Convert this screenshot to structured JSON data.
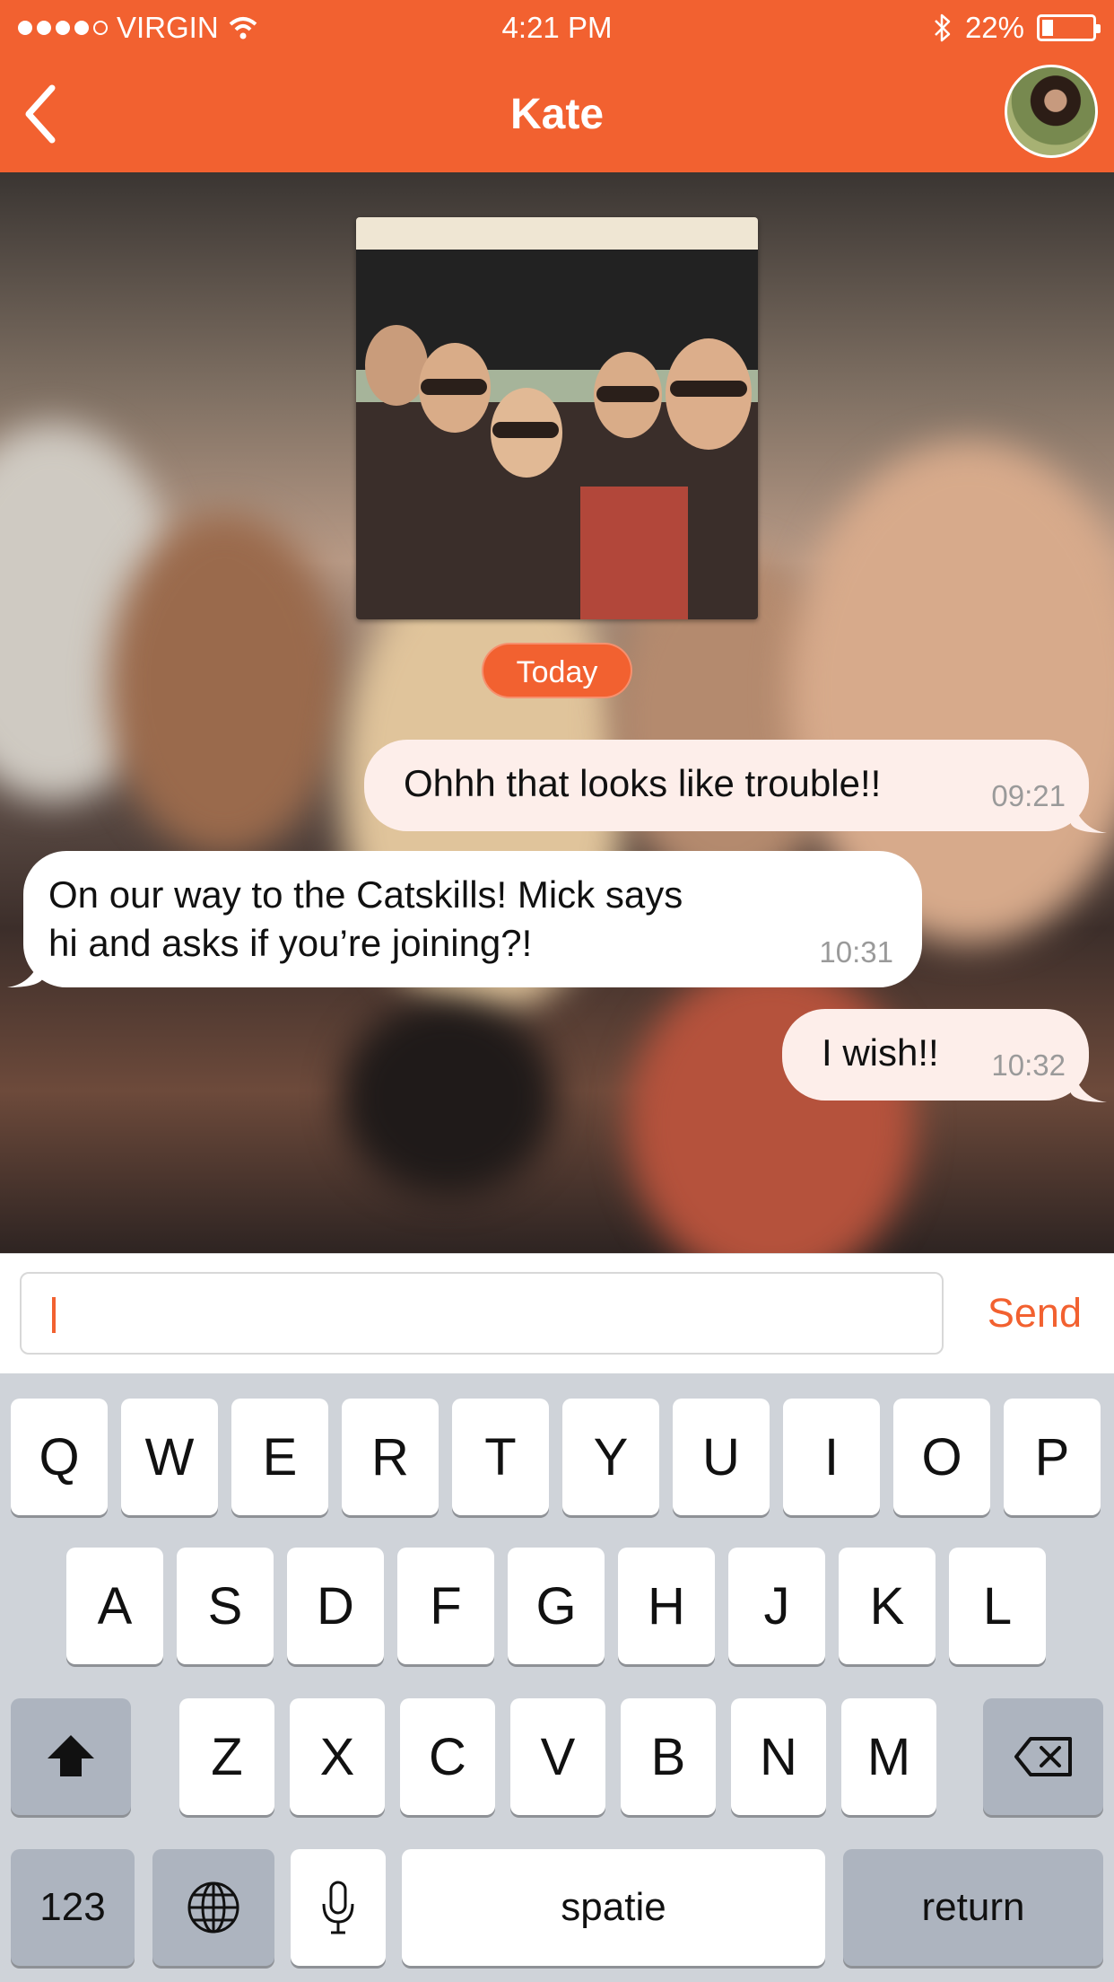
{
  "status_bar": {
    "carrier": "VIRGIN",
    "time": "4:21 PM",
    "battery": "22%",
    "signal_bars_filled": 4,
    "signal_bars_total": 5,
    "battery_level": 0.22,
    "icons": [
      "wifi-icon",
      "bluetooth-icon",
      "battery-icon"
    ]
  },
  "header": {
    "title": "Kate",
    "back_icon": "chevron-left-icon",
    "avatar": "contact-avatar"
  },
  "chat": {
    "date_label": "Today",
    "messages": [
      {
        "direction": "outgoing",
        "text": "Ohhh that looks like trouble!!",
        "time": "09:21"
      },
      {
        "direction": "incoming",
        "line1": "On our way to the Catskills! Mick says",
        "line2": "hi and asks if you’re joining?!",
        "time": "10:31"
      },
      {
        "direction": "outgoing",
        "text": "I wish!!",
        "time": "10:32"
      }
    ]
  },
  "composer": {
    "value": "",
    "send_label": "Send"
  },
  "keyboard": {
    "row1": [
      "Q",
      "W",
      "E",
      "R",
      "T",
      "Y",
      "U",
      "I",
      "O",
      "P"
    ],
    "row2": [
      "A",
      "S",
      "D",
      "F",
      "G",
      "H",
      "J",
      "K",
      "L"
    ],
    "row3": [
      "Z",
      "X",
      "C",
      "V",
      "B",
      "N",
      "M"
    ],
    "numbers_label": "123",
    "space_label": "spatie",
    "return_label": "return",
    "icons": [
      "shift-icon",
      "backspace-icon",
      "globe-icon",
      "microphone-icon"
    ]
  },
  "colors": {
    "accent": "#f26130",
    "outgoing_bubble": "#fdeeea",
    "incoming_bubble": "#ffffff",
    "keyboard_bg": "#cfd3d9"
  }
}
